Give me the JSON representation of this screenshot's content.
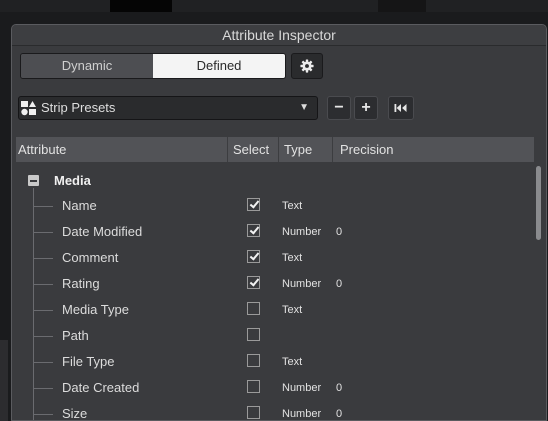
{
  "window": {
    "title": "Attribute Inspector"
  },
  "mode_toggle": {
    "options": [
      "Dynamic",
      "Defined"
    ],
    "selected": "Defined"
  },
  "settings": {
    "icon": "gear-icon"
  },
  "presets": {
    "value": "Strip Presets",
    "icon": "strip-presets-icon"
  },
  "preset_buttons": {
    "remove": "−",
    "add": "+",
    "reset_icon": "skip-back-icon"
  },
  "table": {
    "columns": {
      "attribute": "Attribute",
      "select": "Select",
      "type": "Type",
      "precision": "Precision"
    },
    "group": {
      "label": "Media",
      "expanded": true
    },
    "rows": [
      {
        "name": "Name",
        "selected": true,
        "type": "Text",
        "precision": ""
      },
      {
        "name": "Date Modified",
        "selected": true,
        "type": "Number",
        "precision": "0"
      },
      {
        "name": "Comment",
        "selected": true,
        "type": "Text",
        "precision": ""
      },
      {
        "name": "Rating",
        "selected": true,
        "type": "Number",
        "precision": "0"
      },
      {
        "name": "Media Type",
        "selected": false,
        "type": "Text",
        "precision": ""
      },
      {
        "name": "Path",
        "selected": false,
        "type": "",
        "precision": ""
      },
      {
        "name": "File Type",
        "selected": false,
        "type": "Text",
        "precision": ""
      },
      {
        "name": "Date Created",
        "selected": false,
        "type": "Number",
        "precision": "0"
      },
      {
        "name": "Size",
        "selected": false,
        "type": "Number",
        "precision": "0"
      }
    ]
  },
  "colors": {
    "window_bg": "#3a3b3e",
    "header_bg": "#525357",
    "toggle_on": "#f4f4f4",
    "toggle_off": "#4d4e52"
  }
}
